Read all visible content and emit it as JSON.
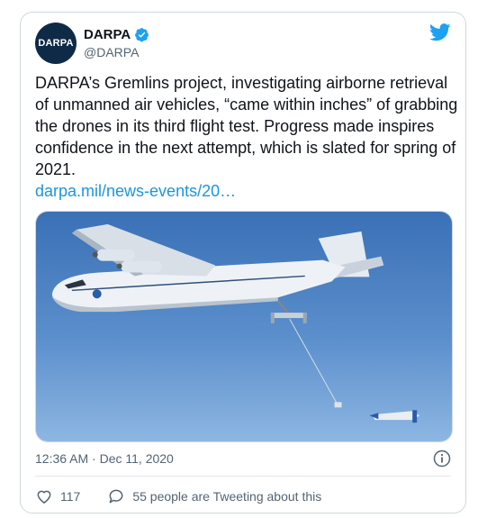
{
  "account": {
    "avatar_text": "DARPA",
    "name": "DARPA",
    "handle": "@DARPA"
  },
  "icons": {
    "verified": "verified-badge-icon",
    "brand": "twitter-bird-icon",
    "info": "info-icon",
    "like": "heart-icon",
    "reply": "speech-bubble-icon"
  },
  "tweet": {
    "text": "DARPA’s Gremlins project, investigating airborne retrieval of unmanned air vehicles, “came within inches” of grabbing the drones in its third flight test. Progress made inspires confidence in the next attempt, which is slated for spring of 2021.",
    "link": "darpa.mil/news-events/20…",
    "timestamp": "12:36 AM · Dec 11, 2020"
  },
  "stats": {
    "likes": "117",
    "discussion": "55 people are Tweeting about this"
  },
  "colors": {
    "accent": "#1da1f2",
    "link": "#1b95e0",
    "text": "#0f1419",
    "muted": "#536471"
  }
}
